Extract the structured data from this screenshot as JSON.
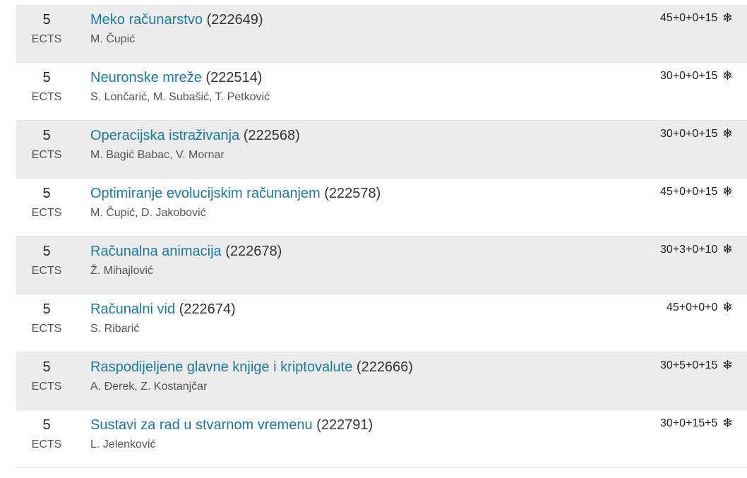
{
  "icon_semester": "snowflake-icon",
  "colors": {
    "link": "#1a7a9e",
    "row_shaded": "#ececec",
    "text": "#222222",
    "muted": "#555555"
  },
  "courses": [
    {
      "ects": "5",
      "ects_unit": "ECTS",
      "name": "Meko računarstvo",
      "code": "(222649)",
      "lecturers": "M. Čupić",
      "hours": "45+0+0+15",
      "semester_icon": "❄"
    },
    {
      "ects": "5",
      "ects_unit": "ECTS",
      "name": "Neuronske mreže",
      "code": "(222514)",
      "lecturers": "S. Lončarić, M. Subašić, T. Petković",
      "hours": "30+0+0+15",
      "semester_icon": "❄"
    },
    {
      "ects": "5",
      "ects_unit": "ECTS",
      "name": "Operacijska istraživanja",
      "code": "(222568)",
      "lecturers": "M. Bagić Babac, V. Mornar",
      "hours": "30+0+0+15",
      "semester_icon": "❄"
    },
    {
      "ects": "5",
      "ects_unit": "ECTS",
      "name": "Optimiranje evolucijskim računanjem",
      "code": "(222578)",
      "lecturers": "M. Čupić, D. Jakobović",
      "hours": "45+0+0+15",
      "semester_icon": "❄"
    },
    {
      "ects": "5",
      "ects_unit": "ECTS",
      "name": "Računalna animacija",
      "code": "(222678)",
      "lecturers": "Ž. Mihajlović",
      "hours": "30+3+0+10",
      "semester_icon": "❄"
    },
    {
      "ects": "5",
      "ects_unit": "ECTS",
      "name": "Računalni vid",
      "code": "(222674)",
      "lecturers": "S. Ribarić",
      "hours": "45+0+0+0",
      "semester_icon": "❄"
    },
    {
      "ects": "5",
      "ects_unit": "ECTS",
      "name": "Raspodijeljene glavne knjige i kriptovalute",
      "code": "(222666)",
      "lecturers": "A. Đerek, Z. Kostanjčar",
      "hours": "30+5+0+15",
      "semester_icon": "❄"
    },
    {
      "ects": "5",
      "ects_unit": "ECTS",
      "name": "Sustavi za rad u stvarnom vremenu",
      "code": "(222791)",
      "lecturers": "L. Jelenković",
      "hours": "30+0+15+5",
      "semester_icon": "❄"
    }
  ]
}
